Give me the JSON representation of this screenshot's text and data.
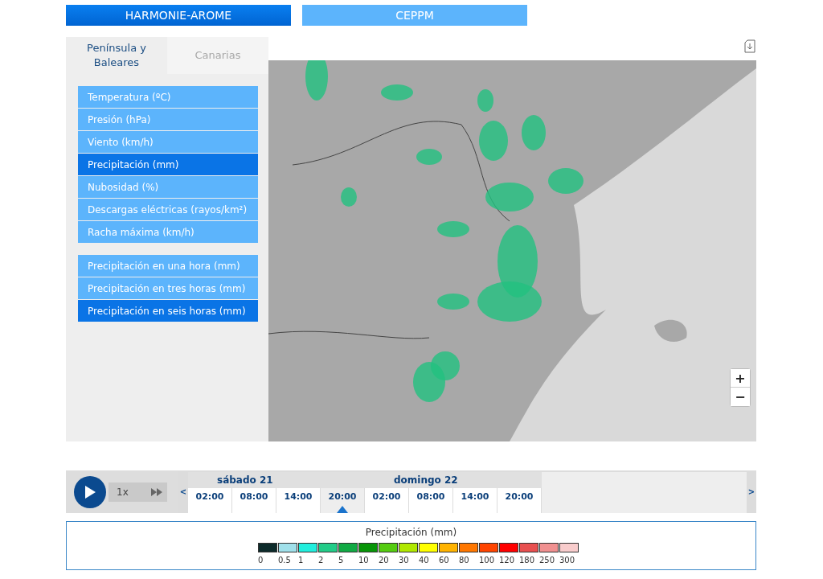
{
  "models": [
    {
      "label": "HARMONIE-AROME",
      "selected": true
    },
    {
      "label": "CEPPM",
      "selected": false
    }
  ],
  "regions": [
    {
      "label": "Península y Baleares",
      "selected": true
    },
    {
      "label": "Canarias",
      "selected": false
    }
  ],
  "variable_groups": [
    [
      {
        "label": "Temperatura (ºC)",
        "selected": false
      },
      {
        "label": "Presión (hPa)",
        "selected": false
      },
      {
        "label": "Viento (km/h)",
        "selected": false
      },
      {
        "label": "Precipitación (mm)",
        "selected": true
      },
      {
        "label": "Nubosidad (%)",
        "selected": false
      },
      {
        "label": "Descargas eléctricas (rayos/km²)",
        "selected": false
      },
      {
        "label": "Racha máxima (km/h)",
        "selected": false
      }
    ],
    [
      {
        "label": "Precipitación en una hora (mm)",
        "selected": false
      },
      {
        "label": "Precipitación en tres horas (mm)",
        "selected": false
      },
      {
        "label": "Precipitación en seis horas (mm)",
        "selected": true
      }
    ]
  ],
  "player": {
    "speed": "1x",
    "prev": "<",
    "next": ">"
  },
  "days": [
    {
      "label": "sábado 21",
      "hours": [
        {
          "label": "02:00",
          "selected": false
        },
        {
          "label": "08:00",
          "selected": false
        },
        {
          "label": "14:00",
          "selected": false
        },
        {
          "label": "20:00",
          "selected": true
        }
      ]
    },
    {
      "label": "domingo 22",
      "hours": [
        {
          "label": "02:00",
          "selected": false
        },
        {
          "label": "08:00",
          "selected": false
        },
        {
          "label": "14:00",
          "selected": false
        },
        {
          "label": "20:00",
          "selected": false
        }
      ]
    }
  ],
  "legend": {
    "title": "Precipitación (mm)",
    "steps": [
      {
        "label": "0",
        "color": "#0d2b2b"
      },
      {
        "label": "0.5",
        "color": "#a0e0ea"
      },
      {
        "label": "1",
        "color": "#22eedd"
      },
      {
        "label": "2",
        "color": "#22cc88"
      },
      {
        "label": "5",
        "color": "#11aa44"
      },
      {
        "label": "10",
        "color": "#079507"
      },
      {
        "label": "20",
        "color": "#55cc11"
      },
      {
        "label": "30",
        "color": "#b0e800"
      },
      {
        "label": "40",
        "color": "#ffff00"
      },
      {
        "label": "60",
        "color": "#ffb300"
      },
      {
        "label": "80",
        "color": "#ff7700"
      },
      {
        "label": "100",
        "color": "#ff4400"
      },
      {
        "label": "120",
        "color": "#ff0000"
      },
      {
        "label": "180",
        "color": "#e85050"
      },
      {
        "label": "250",
        "color": "#f09090"
      },
      {
        "label": "300",
        "color": "#f8cccc"
      }
    ]
  },
  "zoom": {
    "in": "+",
    "out": "−"
  }
}
